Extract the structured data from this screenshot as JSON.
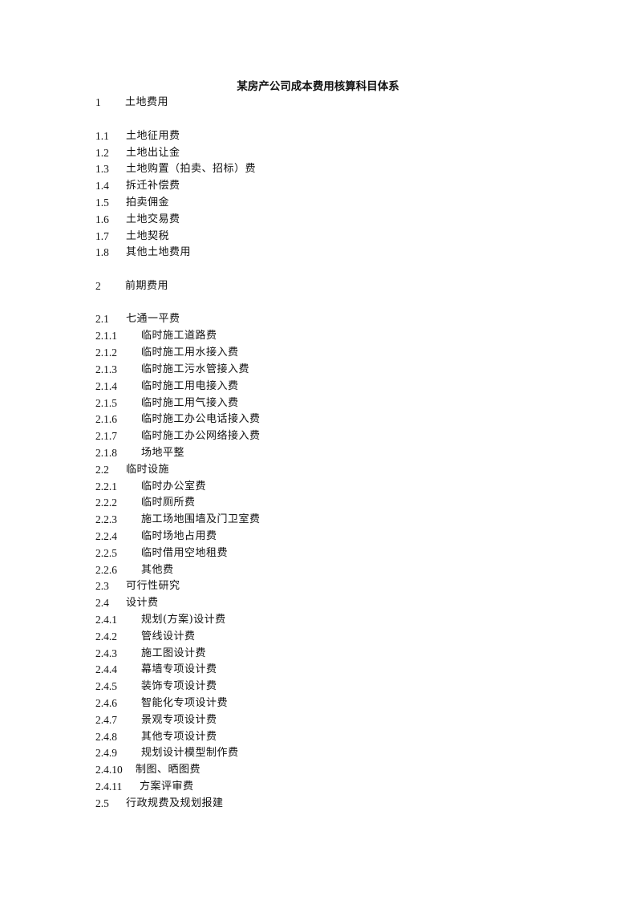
{
  "document": {
    "title": "某房产公司成本费用核算科目体系",
    "entries": [
      {
        "num": "1",
        "text": "土地费用",
        "level": 1
      },
      {
        "num": "1.1",
        "text": "土地征用费",
        "level": 2
      },
      {
        "num": "1.2",
        "text": "土地出让金",
        "level": 2
      },
      {
        "num": "1.3",
        "text": "土地购置（拍卖、招标）费",
        "level": 2
      },
      {
        "num": "1.4",
        "text": "拆迁补偿费",
        "level": 2
      },
      {
        "num": "1.5",
        "text": "拍卖佣金",
        "level": 2
      },
      {
        "num": "1.6",
        "text": "土地交易费",
        "level": 2
      },
      {
        "num": "1.7",
        "text": "土地契税",
        "level": 2
      },
      {
        "num": "1.8",
        "text": "其他土地费用",
        "level": 2
      },
      {
        "num": "2",
        "text": "前期费用",
        "level": 1
      },
      {
        "num": "2.1",
        "text": "七通一平费",
        "level": 2
      },
      {
        "num": "2.1.1",
        "text": "临时施工道路费",
        "level": 3
      },
      {
        "num": "2.1.2",
        "text": "临时施工用水接入费",
        "level": 3
      },
      {
        "num": "2.1.3",
        "text": "临时施工污水管接入费",
        "level": 3
      },
      {
        "num": "2.1.4",
        "text": "临时施工用电接入费",
        "level": 3
      },
      {
        "num": "2.1.5",
        "text": "临时施工用气接入费",
        "level": 3
      },
      {
        "num": "2.1.6",
        "text": "临时施工办公电话接入费",
        "level": 3
      },
      {
        "num": "2.1.7",
        "text": "临时施工办公网络接入费",
        "level": 3
      },
      {
        "num": "2.1.8",
        "text": "场地平整",
        "level": 3
      },
      {
        "num": "2.2",
        "text": "临时设施",
        "level": 2
      },
      {
        "num": "2.2.1",
        "text": "临时办公室费",
        "level": 3
      },
      {
        "num": "2.2.2",
        "text": "临时厕所费",
        "level": 3
      },
      {
        "num": "2.2.3",
        "text": "施工场地围墙及门卫室费",
        "level": 3
      },
      {
        "num": "2.2.4",
        "text": "临时场地占用费",
        "level": 3
      },
      {
        "num": "2.2.5",
        "text": "临时借用空地租费",
        "level": 3
      },
      {
        "num": "2.2.6",
        "text": "其他费",
        "level": 3
      },
      {
        "num": "2.3",
        "text": "可行性研究",
        "level": 2
      },
      {
        "num": "2.4",
        "text": "设计费",
        "level": 2
      },
      {
        "num": "2.4.1",
        "text": "规划(方案)设计费",
        "level": 3
      },
      {
        "num": "2.4.2",
        "text": "管线设计费",
        "level": 3
      },
      {
        "num": "2.4.3",
        "text": "施工图设计费",
        "level": 3
      },
      {
        "num": "2.4.4",
        "text": "幕墙专项设计费",
        "level": 3
      },
      {
        "num": "2.4.5",
        "text": "装饰专项设计费",
        "level": 3
      },
      {
        "num": "2.4.6",
        "text": "智能化专项设计费",
        "level": 3
      },
      {
        "num": "2.4.7",
        "text": "景观专项设计费",
        "level": 3
      },
      {
        "num": "2.4.8",
        "text": "其他专项设计费",
        "level": 3
      },
      {
        "num": "2.4.9",
        "text": "规划设计模型制作费",
        "level": 3
      },
      {
        "num": "2.4.10",
        "text": "制图、晒图费",
        "level": 3
      },
      {
        "num": "2.4.11",
        "text": "方案评审费",
        "level": 3
      },
      {
        "num": "2.5",
        "text": "行政规费及规划报建",
        "level": 2
      }
    ]
  }
}
